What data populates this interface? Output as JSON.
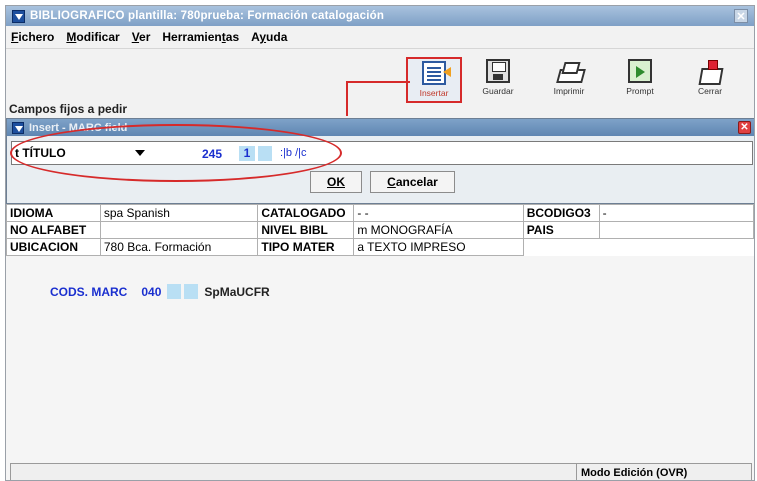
{
  "window": {
    "title": "BIBLIOGRAFICO plantilla: 780prueba: Formación catalogación",
    "close_glyph": "✕"
  },
  "menu": [
    {
      "label": "Fichero",
      "mnemonic": "F"
    },
    {
      "label": "Modificar",
      "mnemonic": "M"
    },
    {
      "label": "Ver",
      "mnemonic": "V"
    },
    {
      "label": "Herramientas",
      "mnemonic": "t"
    },
    {
      "label": "Ayuda",
      "mnemonic": "y"
    }
  ],
  "toolbar": {
    "insert_label": "Insertar",
    "save_label": "Guardar",
    "print_label": "Imprimir",
    "prompt_label": "Prompt",
    "close_label": "Cerrar",
    "highlight_color": "#d62a2a"
  },
  "section_label": "Campos fijos a pedir",
  "dialog": {
    "title": "Insert - MARC field",
    "field_combo": "t TÍTULO",
    "tag": "245",
    "ind1": "1",
    "subfields": ":|b /|c",
    "ok_label": "OK",
    "cancel_label": "Cancelar"
  },
  "fixed_fields": [
    [
      "IDIOMA",
      "spa  Spanish",
      "CATALOGADO",
      "- -",
      "BCODIGO3",
      "-"
    ],
    [
      "NO ALFABET",
      "",
      "NIVEL BIBL",
      "m  MONOGRAFÍA",
      "PAIS",
      ""
    ],
    [
      "UBICACION",
      "780   Bca. Formación",
      "TIPO MATER",
      "a  TEXTO IMPRESO",
      "",
      ""
    ]
  ],
  "marc_codes": {
    "label": "CODS. MARC",
    "tag": "040",
    "value": "SpMaUCFR"
  },
  "status": {
    "mode": "Modo Edición (OVR)"
  },
  "colors": {
    "accent_blue": "#1a2fcf",
    "indicator_bg": "#b9dff4",
    "annotation_red": "#d62a2a"
  }
}
